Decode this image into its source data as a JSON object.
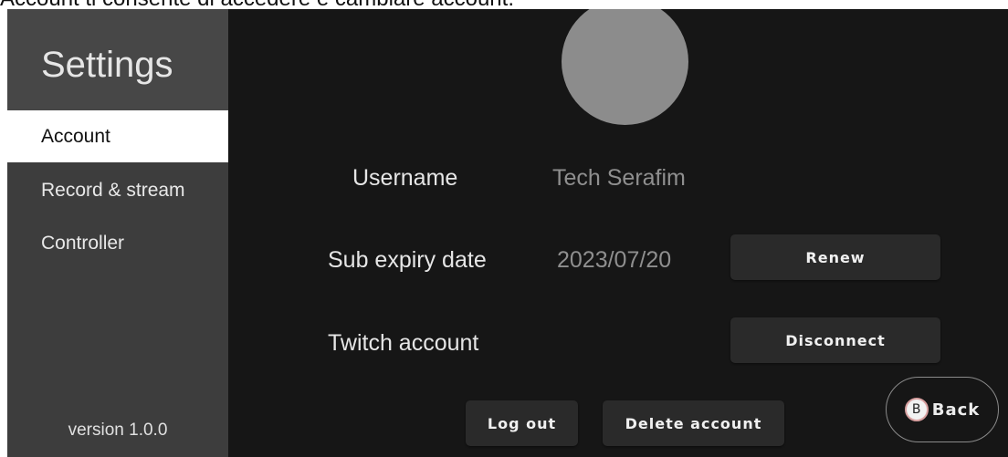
{
  "caption": "Account ti consente di accedere e cambiare account.",
  "sidebar": {
    "title": "Settings",
    "items": [
      {
        "label": "Account",
        "active": true
      },
      {
        "label": "Record & stream",
        "active": false
      },
      {
        "label": "Controller",
        "active": false
      }
    ],
    "version": "version 1.0.0"
  },
  "account": {
    "username_label": "Username",
    "username_value": "Tech Serafim",
    "expiry_label": "Sub expiry date",
    "expiry_value": "2023/07/20",
    "renew_label": "Renew",
    "twitch_label": "Twitch account",
    "disconnect_label": "Disconnect",
    "logout_label": "Log out",
    "delete_label": "Delete account"
  },
  "back": {
    "icon_letter": "B",
    "label": "Back"
  },
  "colors": {
    "background": "#161616",
    "sidebar": "#3d3d3d",
    "sidebar_header": "#474747",
    "active_item": "#ffffff",
    "avatar": "#8c8c8c",
    "button": "#2a2a2a"
  }
}
